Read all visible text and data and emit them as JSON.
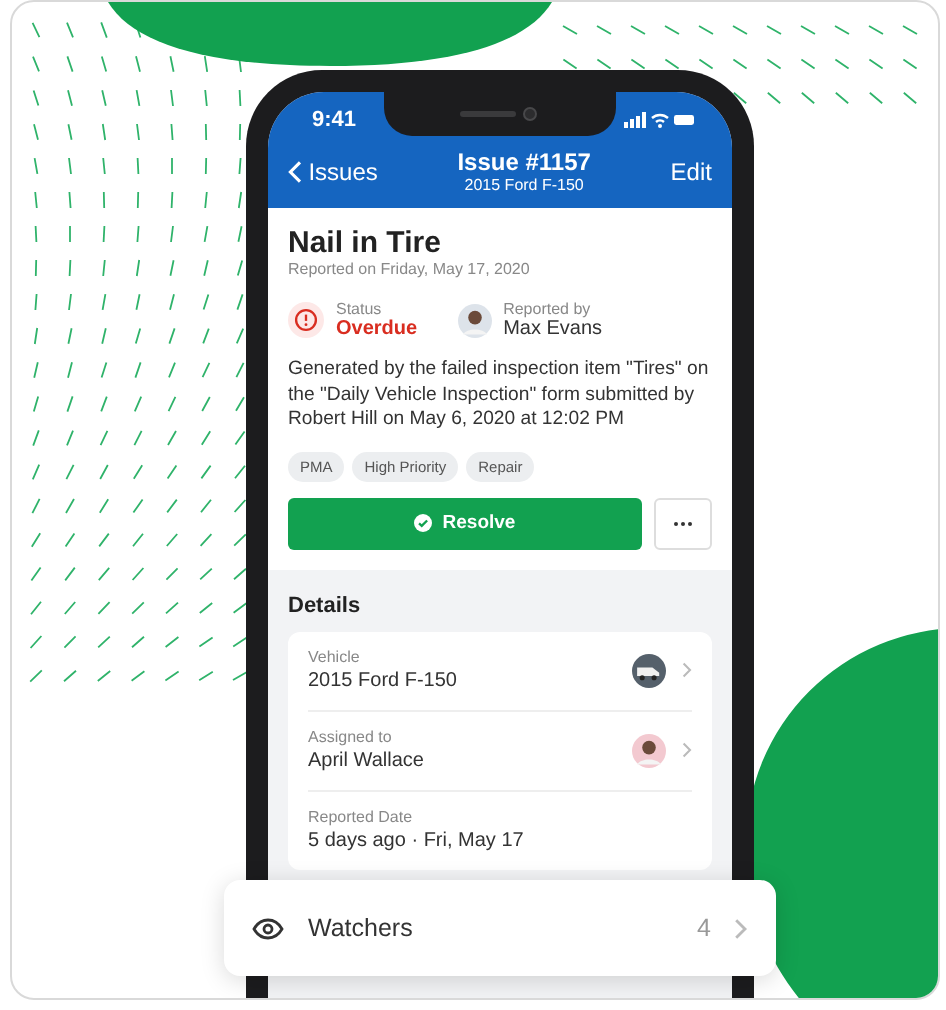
{
  "status_bar": {
    "time": "9:41"
  },
  "nav": {
    "back": "Issues",
    "title": "Issue #1157",
    "subtitle": "2015 Ford F-150",
    "action": "Edit"
  },
  "issue": {
    "title": "Nail in Tire",
    "reported_on": "Reported on Friday, May 17, 2020",
    "status": {
      "label": "Status",
      "value": "Overdue"
    },
    "reporter": {
      "label": "Reported by",
      "name": "Max Evans"
    },
    "description": "Generated by the failed inspection item \"Tires\" on the \"Daily Vehicle Inspection\" form submitted by Robert Hill on May 6, 2020 at 12:02 PM",
    "tags": [
      "PMA",
      "High Priority",
      "Repair"
    ],
    "resolve_button": "Resolve"
  },
  "details": {
    "heading": "Details",
    "rows": [
      {
        "label": "Vehicle",
        "value": "2015 Ford F-150",
        "kind": "vehicle"
      },
      {
        "label": "Assigned to",
        "value": "April Wallace",
        "kind": "person"
      },
      {
        "label": "Reported Date",
        "value": "5 days ago · Fri, May 17",
        "kind": "plain"
      }
    ]
  },
  "watchers": {
    "label": "Watchers",
    "count": "4"
  }
}
